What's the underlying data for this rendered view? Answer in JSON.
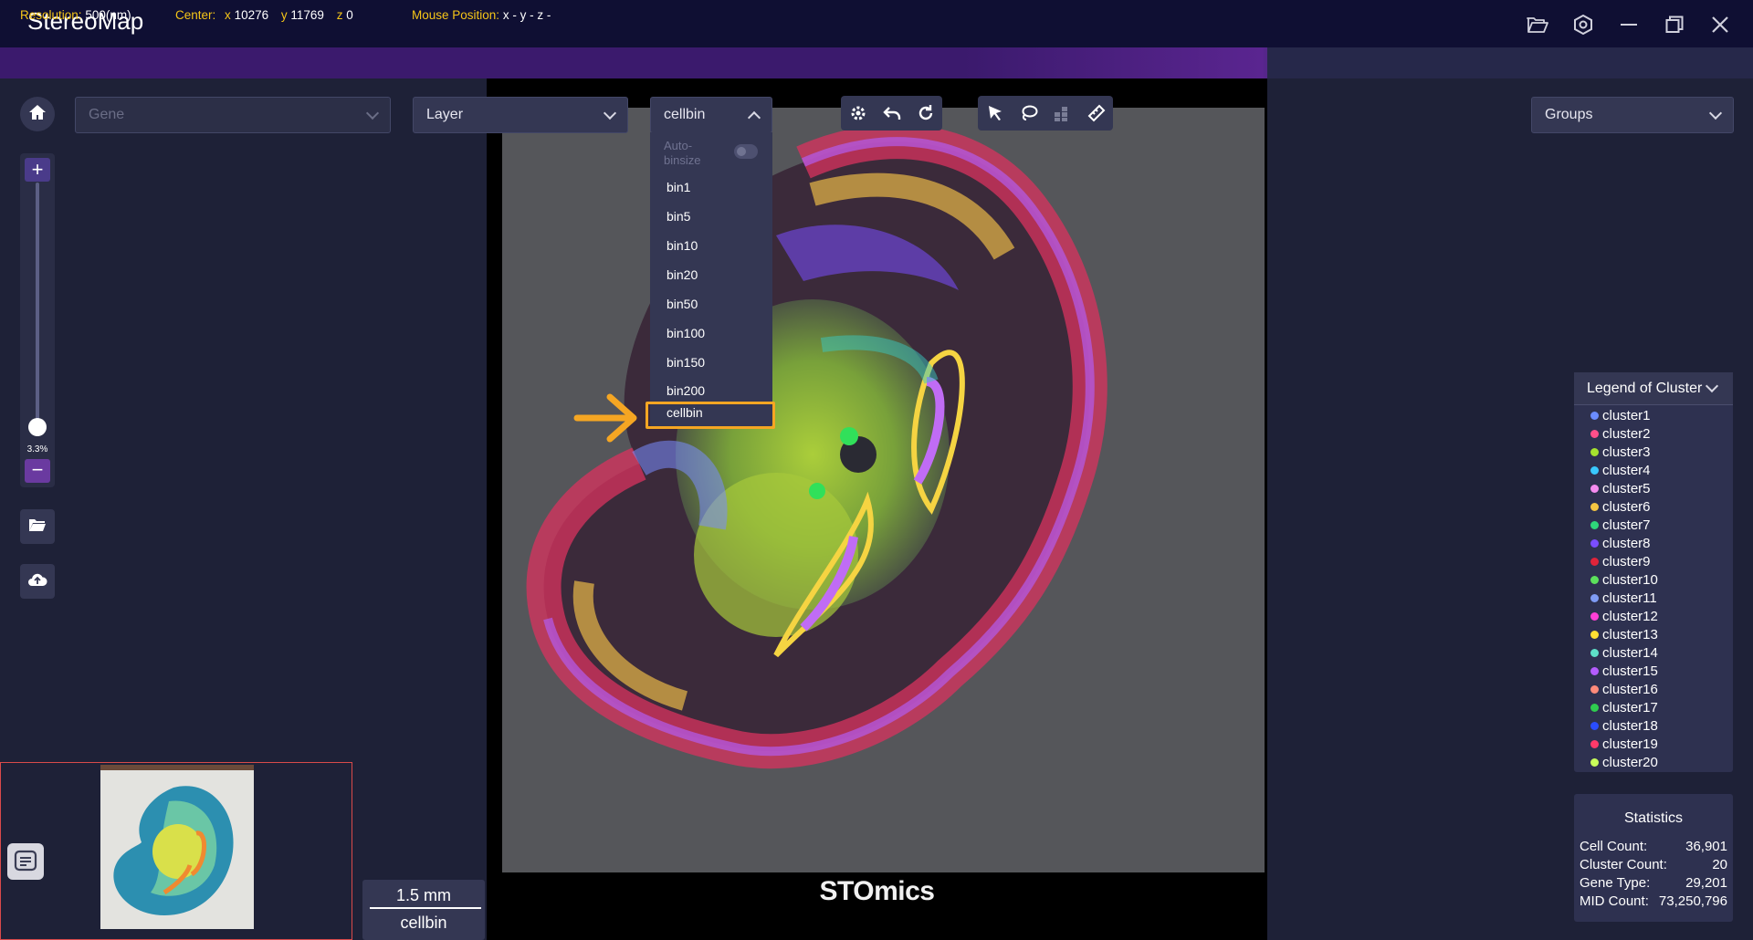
{
  "app": {
    "title": "StereoMap"
  },
  "window_controls": {
    "icons": [
      "folder-open-icon",
      "settings-icon",
      "minimize-icon",
      "restore-icon",
      "close-icon"
    ]
  },
  "infobar": {
    "resolution_key": "Resolution:",
    "resolution_value": "500(nm)",
    "center_key": "Center:",
    "center_x_key": "x",
    "center_x": "10276",
    "center_y_key": "y",
    "center_y": "11769",
    "center_z_key": "z",
    "center_z": "0",
    "mouse_key": "Mouse Position:",
    "mouse_value": "x -  y -  z -"
  },
  "controls": {
    "gene_placeholder": "Gene",
    "layer_label": "Layer",
    "bin_selected": "cellbin",
    "groups_label": "Groups"
  },
  "bin_dropdown": {
    "auto_binsize_label": "Auto-binsize",
    "options": [
      "bin1",
      "bin5",
      "bin10",
      "bin20",
      "bin50",
      "bin100",
      "bin150",
      "bin200",
      "cellbin"
    ],
    "highlighted": "cellbin"
  },
  "zoom": {
    "percent_label": "3.3%",
    "plus": "+",
    "minus": "−",
    "level": 0.033
  },
  "viewport": {
    "brand": "STOmics"
  },
  "legend": {
    "title": "Legend of Cluster",
    "items": [
      {
        "label": "cluster1",
        "color": "#6b8cff"
      },
      {
        "label": "cluster2",
        "color": "#ff4f8a"
      },
      {
        "label": "cluster3",
        "color": "#a6e22e"
      },
      {
        "label": "cluster4",
        "color": "#39c8ff"
      },
      {
        "label": "cluster5",
        "color": "#f58cf0"
      },
      {
        "label": "cluster6",
        "color": "#f5c542"
      },
      {
        "label": "cluster7",
        "color": "#2ed67a"
      },
      {
        "label": "cluster8",
        "color": "#7a4dff"
      },
      {
        "label": "cluster9",
        "color": "#e0243a"
      },
      {
        "label": "cluster10",
        "color": "#5ce05c"
      },
      {
        "label": "cluster11",
        "color": "#7f9cf5"
      },
      {
        "label": "cluster12",
        "color": "#ff3fd6"
      },
      {
        "label": "cluster13",
        "color": "#ffe033"
      },
      {
        "label": "cluster14",
        "color": "#5ee0c8"
      },
      {
        "label": "cluster15",
        "color": "#b45cff"
      },
      {
        "label": "cluster16",
        "color": "#ff8a7a"
      },
      {
        "label": "cluster17",
        "color": "#2fcc4f"
      },
      {
        "label": "cluster18",
        "color": "#2a4dff"
      },
      {
        "label": "cluster19",
        "color": "#ff3a6a"
      },
      {
        "label": "cluster20",
        "color": "#c8ff5a"
      }
    ]
  },
  "statistics": {
    "title": "Statistics",
    "rows": [
      {
        "key": "Cell Count:",
        "value": "36,901"
      },
      {
        "key": "Cluster Count:",
        "value": "20"
      },
      {
        "key": "Gene Type:",
        "value": "29,201"
      },
      {
        "key": "MID Count:",
        "value": "73,250,796"
      }
    ]
  },
  "scale": {
    "length": "1.5 mm",
    "bin": "cellbin"
  }
}
